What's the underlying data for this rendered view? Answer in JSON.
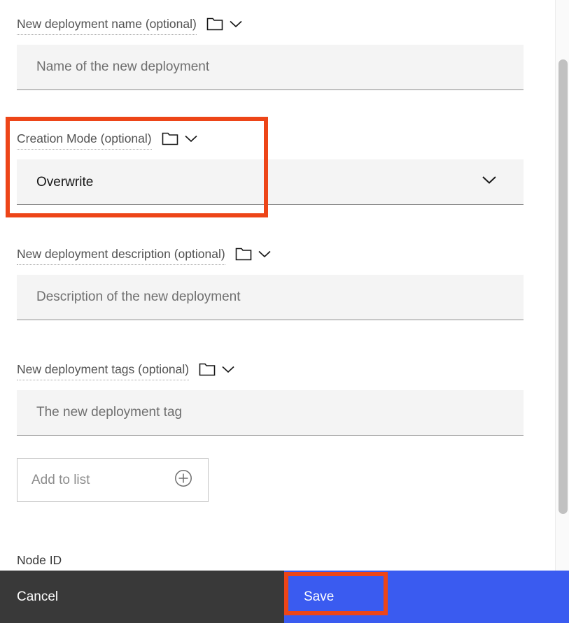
{
  "form": {
    "fields": [
      {
        "id": "new-deployment-name",
        "label": "New deployment name (optional)",
        "placeholder": "Name of the new deployment",
        "type": "text",
        "folder_icon": "folder-icon",
        "chevron_icon": "chevron-down-icon"
      },
      {
        "id": "creation-mode",
        "label": "Creation Mode (optional)",
        "value": "Overwrite",
        "type": "select",
        "folder_icon": "folder-icon",
        "chevron_icon": "chevron-down-icon",
        "dropdown_icon": "chevron-down-icon"
      },
      {
        "id": "new-deployment-description",
        "label": "New deployment description (optional)",
        "placeholder": "Description of the new deployment",
        "type": "text",
        "folder_icon": "folder-icon",
        "chevron_icon": "chevron-down-icon"
      },
      {
        "id": "new-deployment-tags",
        "label": "New deployment tags (optional)",
        "placeholder": "The new deployment tag",
        "type": "text",
        "folder_icon": "folder-icon",
        "chevron_icon": "chevron-down-icon"
      }
    ],
    "add_to_list": {
      "label": "Add to list",
      "icon": "add-circle-icon"
    },
    "node_id_label": "Node ID"
  },
  "action_bar": {
    "cancel_label": "Cancel",
    "save_label": "Save",
    "cancel_color": "#393939",
    "save_color": "#3a5bf0"
  },
  "annotations": {
    "highlight_color": "#ed4518",
    "boxes": [
      {
        "name": "creation-mode-highlight"
      },
      {
        "name": "save-button-highlight"
      }
    ]
  },
  "scrollbar": {
    "orientation": "vertical",
    "thumb_color": "#c1c1c1"
  }
}
